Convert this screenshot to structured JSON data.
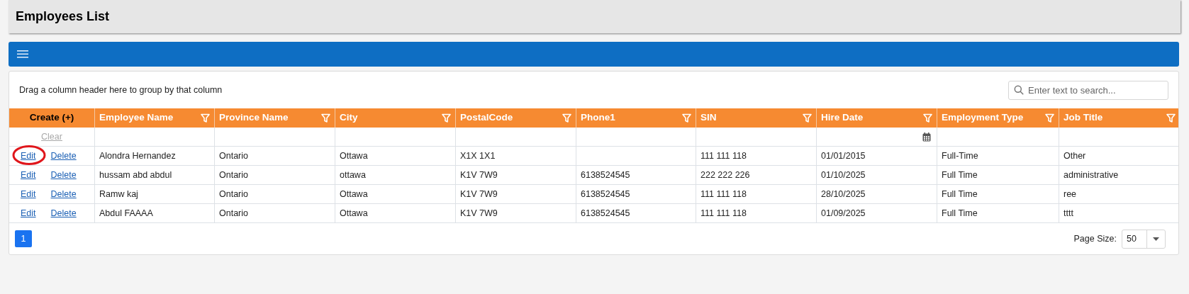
{
  "page": {
    "title": "Employees List"
  },
  "grid": {
    "group_hint": "Drag a column header here to group by that column",
    "search": {
      "placeholder": "Enter text to search..."
    },
    "create_label": "Create (+)",
    "clear_label": "Clear",
    "columns": [
      {
        "label": "Employee Name",
        "kind": "text"
      },
      {
        "label": "Province Name",
        "kind": "text"
      },
      {
        "label": "City",
        "kind": "text"
      },
      {
        "label": "PostalCode",
        "kind": "text"
      },
      {
        "label": "Phone1",
        "kind": "text"
      },
      {
        "label": "SIN",
        "kind": "text"
      },
      {
        "label": "Hire Date",
        "kind": "date"
      },
      {
        "label": "Employment Type",
        "kind": "text"
      },
      {
        "label": "Job Title",
        "kind": "text"
      }
    ],
    "rows": [
      {
        "edit": "Edit",
        "delete": "Delete",
        "circled": true,
        "cells": [
          "Alondra Hernandez",
          "Ontario",
          "Ottawa",
          "X1X 1X1",
          "",
          "111 111 118",
          "01/01/2015",
          "Full-Time",
          "Other"
        ]
      },
      {
        "edit": "Edit",
        "delete": "Delete",
        "circled": false,
        "cells": [
          "hussam abd abdul",
          "Ontario",
          "ottawa",
          "K1V 7W9",
          "6138524545",
          "222 222 226",
          "01/10/2025",
          "Full Time",
          "administrative"
        ]
      },
      {
        "edit": "Edit",
        "delete": "Delete",
        "circled": false,
        "cells": [
          "Ramw kaj",
          "Ontario",
          "Ottawa",
          "K1V 7W9",
          "6138524545",
          "111 111 118",
          "28/10/2025",
          "Full Time",
          "ree"
        ]
      },
      {
        "edit": "Edit",
        "delete": "Delete",
        "circled": false,
        "cells": [
          "Abdul FAAAA",
          "Ontario",
          "Ottawa",
          "K1V 7W9",
          "6138524545",
          "111 111 118",
          "01/09/2025",
          "Full Time",
          "tttt"
        ]
      }
    ],
    "pages": [
      {
        "label": "1",
        "selected": true
      }
    ],
    "page_size": {
      "label": "Page Size:",
      "value": "50"
    }
  }
}
